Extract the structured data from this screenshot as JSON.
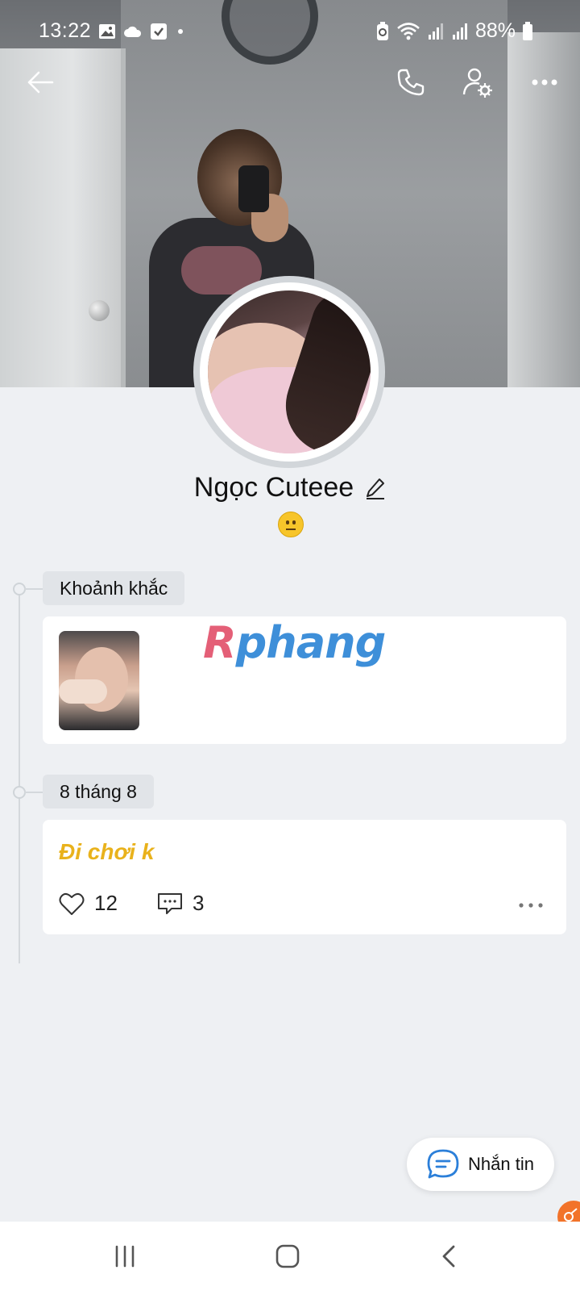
{
  "status_bar": {
    "time": "13:22",
    "battery": "88%"
  },
  "profile": {
    "name": "Ngọc Cuteee",
    "status_emoji": "neutral-face"
  },
  "timeline": {
    "moments_label": "Khoảnh khắc",
    "date_label": "8 tháng 8"
  },
  "watermark": {
    "first": "R",
    "rest": "phang"
  },
  "post": {
    "text": "Đi chơi k",
    "likes": "12",
    "comments": "3"
  },
  "chat_button": {
    "label": "Nhắn tin"
  },
  "colors": {
    "background": "#eef0f3",
    "post_text": "#e9b21c",
    "accent": "#2b7fd9",
    "corner_badge": "#f2732a"
  }
}
